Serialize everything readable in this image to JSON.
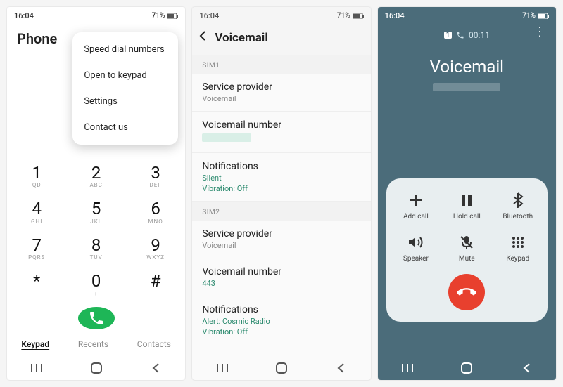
{
  "statusbar": {
    "time": "16:04",
    "battery": "71%"
  },
  "screen1": {
    "title": "Phone",
    "menu": [
      "Speed dial numbers",
      "Open to keypad",
      "Settings",
      "Contact us"
    ],
    "keys": [
      {
        "d": "1",
        "l": "QD"
      },
      {
        "d": "2",
        "l": "ABC"
      },
      {
        "d": "3",
        "l": "DEF"
      },
      {
        "d": "4",
        "l": "GHI"
      },
      {
        "d": "5",
        "l": "JKL"
      },
      {
        "d": "6",
        "l": "MNO"
      },
      {
        "d": "7",
        "l": "PQRS"
      },
      {
        "d": "8",
        "l": "TUV"
      },
      {
        "d": "9",
        "l": "WXYZ"
      },
      {
        "d": "*",
        "l": ""
      },
      {
        "d": "0",
        "l": "+"
      },
      {
        "d": "#",
        "l": ""
      }
    ],
    "tabs": {
      "keypad": "Keypad",
      "recents": "Recents",
      "contacts": "Contacts"
    }
  },
  "screen2": {
    "title": "Voicemail",
    "sim1_label": "SIM1",
    "sim2_label": "SIM2",
    "sim1": {
      "service_t": "Service provider",
      "service_s": "Voicemail",
      "number_t": "Voicemail number",
      "notif_t": "Notifications",
      "notif_s1": "Silent",
      "notif_s2": "Vibration: Off"
    },
    "sim2": {
      "service_t": "Service provider",
      "service_s": "Voicemail",
      "number_t": "Voicemail number",
      "number_s": "443",
      "notif_t": "Notifications",
      "notif_s1": "Alert: Cosmic Radio",
      "notif_s2": "Vibration: Off"
    }
  },
  "screen3": {
    "sim_badge": "1",
    "timer": "00:11",
    "title": "Voicemail",
    "buttons": {
      "add": "Add call",
      "hold": "Hold call",
      "bt": "Bluetooth",
      "speaker": "Speaker",
      "mute": "Mute",
      "keypad": "Keypad"
    }
  }
}
